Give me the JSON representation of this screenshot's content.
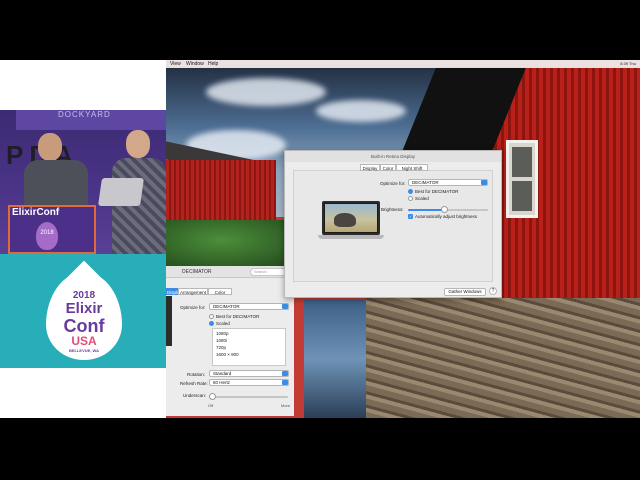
{
  "menubar": {
    "view": "View",
    "window": "Window",
    "help": "Help",
    "status": "8:39  Thu"
  },
  "conference": {
    "banner": "DOCKYARD",
    "podium_label": "ElixirConf",
    "badge_text": "2018",
    "logo": {
      "year": "2018",
      "elixir": "Elixir",
      "conf": "Conf",
      "usa": "USA",
      "location": "BELLEVUE, WA"
    }
  },
  "front_window": {
    "title": "Built-in Retina Display",
    "tabs": [
      "Display",
      "Color",
      "Night Shift"
    ],
    "optimize_label": "Optimize for:",
    "optimize_value": "DECIMATOR",
    "option_best": "Best for DECIMATOR",
    "option_scaled": "Scaled",
    "brightness_label": "Brightness:",
    "brightness_level": 0.45,
    "auto_brightness": "Automatically adjust brightness",
    "gather_button": "Gather Windows",
    "help_glyph": "?"
  },
  "back_window": {
    "title": "DECIMATOR",
    "search_placeholder": "Search",
    "tabs": [
      "Display",
      "Arrangement",
      "Color"
    ],
    "optimize_label": "Optimize for:",
    "optimize_value": "DECIMATOR",
    "option_best": "Best for DECIMATOR",
    "option_scaled": "Scaled",
    "resolutions": [
      "1080p",
      "1080i",
      "720p",
      "1600 × 900"
    ],
    "rotation_label": "Rotation:",
    "rotation_value": "Standard",
    "refresh_label": "Refresh Rate:",
    "refresh_value": "60 Hertz",
    "underscan_label": "Underscan:",
    "underscan_min": "Off",
    "underscan_max": "More"
  },
  "colors": {
    "accent": "#3c8ce7",
    "conference_purple": "#4a3487",
    "conference_teal": "#27aeb8"
  }
}
